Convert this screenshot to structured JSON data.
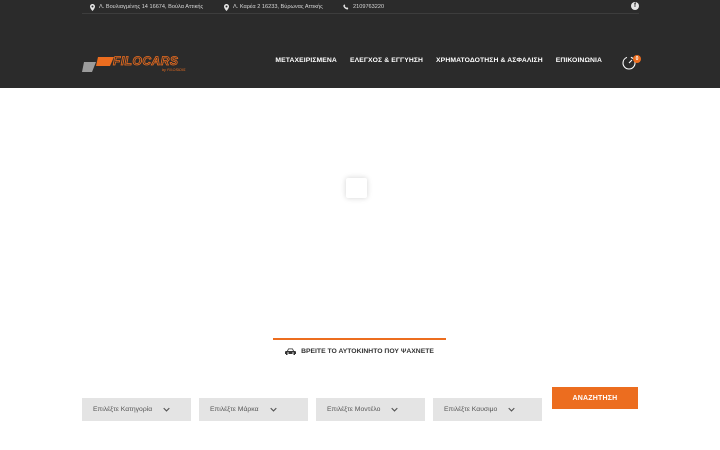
{
  "topbar": {
    "address1": "Λ. Βουλιαγμένης 14 16674, Βούλα Αττικής",
    "address2": "Λ. Καρέα 2 16233, Βύρωνας Αττικής",
    "phone": "2109763220",
    "facebook_icon": "facebook-icon"
  },
  "logo": {
    "brand": "FILOCARS",
    "tagline": "by FILOSIDIS"
  },
  "nav": {
    "items": [
      {
        "label": "ΜΕΤΑΧΕΙΡΙΣΜΕΝΑ"
      },
      {
        "label": "ΕΛΕΓΧΟΣ & ΕΓΓΥΗΣΗ"
      },
      {
        "label": "ΧΡΗΜΑΤΟΔΟΤΗΣΗ & ΑΣΦΑΛΙΣΗ"
      },
      {
        "label": "ΕΠΙΚΟΙΝΩΝΙΑ"
      }
    ],
    "cart_count": "0"
  },
  "search": {
    "tab_label": "ΒΡΕΙΤΕ ΤΟ ΑΥΤΟΚΙΝΗΤΟ ΠΟΥ ΨΑΧΝΕΤΕ",
    "category_placeholder": "Επιλέξτε Κατηγορία",
    "make_placeholder": "Επιλέξτε Μάρκα",
    "model_placeholder": "Επιλέξτε Μοντέλο",
    "fuel_placeholder": "Επιλέξτε Καυσιμο",
    "submit_label": "ΑΝΑΖΗΤΗΣΗ"
  },
  "colors": {
    "accent": "#ec6d1f",
    "header_bg": "#2b2b2b",
    "select_bg": "#e4e4e4"
  }
}
